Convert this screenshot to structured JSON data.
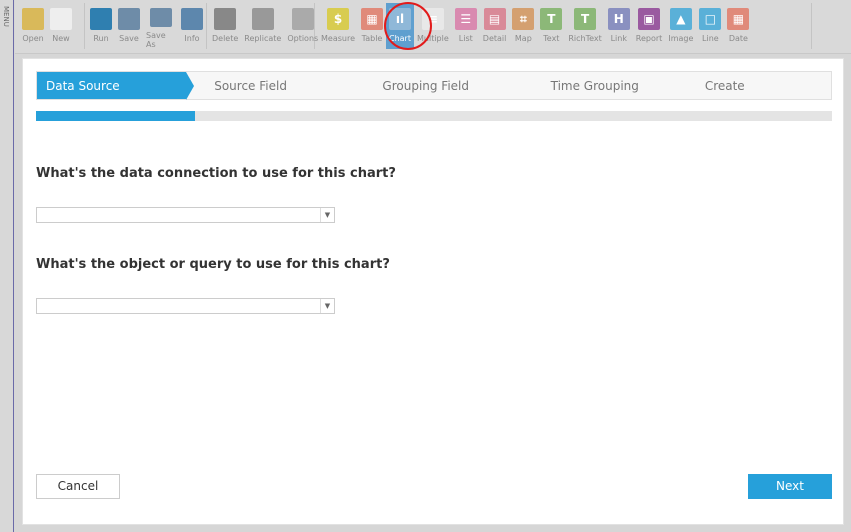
{
  "menu_label": "MENU",
  "toolbar": {
    "file": [
      {
        "label": "Open",
        "icon": "folder-icon",
        "color": "#d9b95a"
      },
      {
        "label": "New",
        "icon": "new-document-icon",
        "color": "#eeeeee"
      }
    ],
    "run": [
      {
        "label": "Run",
        "icon": "run-icon",
        "color": "#2f7fb0"
      },
      {
        "label": "Save",
        "icon": "save-icon",
        "color": "#6e8ca8"
      },
      {
        "label": "Save As",
        "icon": "save-as-icon",
        "color": "#6e8ca8"
      },
      {
        "label": "Info",
        "icon": "info-icon",
        "color": "#5d87ad"
      }
    ],
    "edit": [
      {
        "label": "Delete",
        "icon": "trash-icon",
        "color": "#888888"
      },
      {
        "label": "Replicate",
        "icon": "replicate-icon",
        "color": "#999999"
      },
      {
        "label": "Options",
        "icon": "wrench-icon",
        "color": "#aaaaaa"
      }
    ],
    "widgets": [
      {
        "label": "Measure",
        "icon": "measure-icon",
        "color": "#d8cc50",
        "glyph": "$"
      },
      {
        "label": "Table",
        "icon": "table-icon",
        "color": "#e08a7a",
        "glyph": "▦"
      },
      {
        "label": "Chart",
        "icon": "chart-icon",
        "color": "#8fb8d8",
        "glyph": "ıl",
        "active": true
      },
      {
        "label": "Multiple",
        "icon": "multiple-icon",
        "color": "#e8e8e8",
        "glyph": "≡"
      },
      {
        "label": "List",
        "icon": "list-icon",
        "color": "#d98ab0",
        "glyph": "☰"
      },
      {
        "label": "Detail",
        "icon": "detail-icon",
        "color": "#d98a98",
        "glyph": "▤"
      },
      {
        "label": "Map",
        "icon": "map-icon",
        "color": "#d4a070",
        "glyph": "⌗"
      },
      {
        "label": "Text",
        "icon": "text-icon",
        "color": "#8cb878",
        "glyph": "T"
      },
      {
        "label": "RichText",
        "icon": "richtext-icon",
        "color": "#8cb878",
        "glyph": "T"
      },
      {
        "label": "Link",
        "icon": "link-icon",
        "color": "#8a90c0",
        "glyph": "H"
      },
      {
        "label": "Report",
        "icon": "report-icon",
        "color": "#9a5aa0",
        "glyph": "▣"
      },
      {
        "label": "Image",
        "icon": "image-icon",
        "color": "#5ab0d8",
        "glyph": "▲"
      },
      {
        "label": "Line",
        "icon": "line-icon",
        "color": "#5ab0d8",
        "glyph": "□"
      },
      {
        "label": "Date",
        "icon": "date-icon",
        "color": "#e08a7a",
        "glyph": "▦"
      }
    ]
  },
  "wizard": {
    "steps": [
      "Data Source",
      "Source Field",
      "Grouping Field",
      "Time Grouping",
      "Create"
    ],
    "active_step": 0,
    "progress_percent": 20,
    "question1": "What's the data connection to use for this chart?",
    "connection_value": "",
    "question2": "What's the object or query to use for this chart?",
    "object_value": "",
    "cancel_label": "Cancel",
    "next_label": "Next",
    "accent": "#26a0da"
  }
}
